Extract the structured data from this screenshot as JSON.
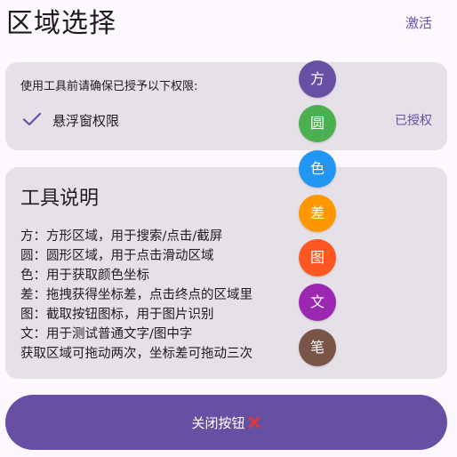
{
  "header": {
    "title": "区域选择",
    "activate_label": "激活"
  },
  "permissions": {
    "hint": "使用工具前请确保已授予以下权限:",
    "items": [
      {
        "name": "悬浮窗权限",
        "status": "已授权",
        "icon": "check-icon"
      }
    ]
  },
  "info": {
    "title": "工具说明",
    "lines": [
      "方：方形区域，用于搜索/点击/截屏",
      "圆：圆形区域，用于点击滑动区域",
      "色：用于获取颜色坐标",
      "差：拖拽获得坐标差，点击终点的区域里",
      "图：截取按钮图标，用于图片识别",
      "文：用于测试普通文字/图中字",
      "获取区域可拖动两次，坐标差可拖动三次"
    ]
  },
  "tools": [
    {
      "label": "方",
      "color": "#6750a4"
    },
    {
      "label": "圆",
      "color": "#4caf50"
    },
    {
      "label": "色",
      "color": "#2196f3"
    },
    {
      "label": "差",
      "color": "#ff9800"
    },
    {
      "label": "图",
      "color": "#ff5722"
    },
    {
      "label": "文",
      "color": "#9c27b0"
    },
    {
      "label": "笔",
      "color": "#795548"
    }
  ],
  "close_button": {
    "label": "关闭按钮",
    "icon": "red-x-icon"
  },
  "colors": {
    "accent": "#6750a4",
    "card_background": "#e6e0e9",
    "page_background": "#fdf7ff",
    "close_x": "#e53935"
  }
}
